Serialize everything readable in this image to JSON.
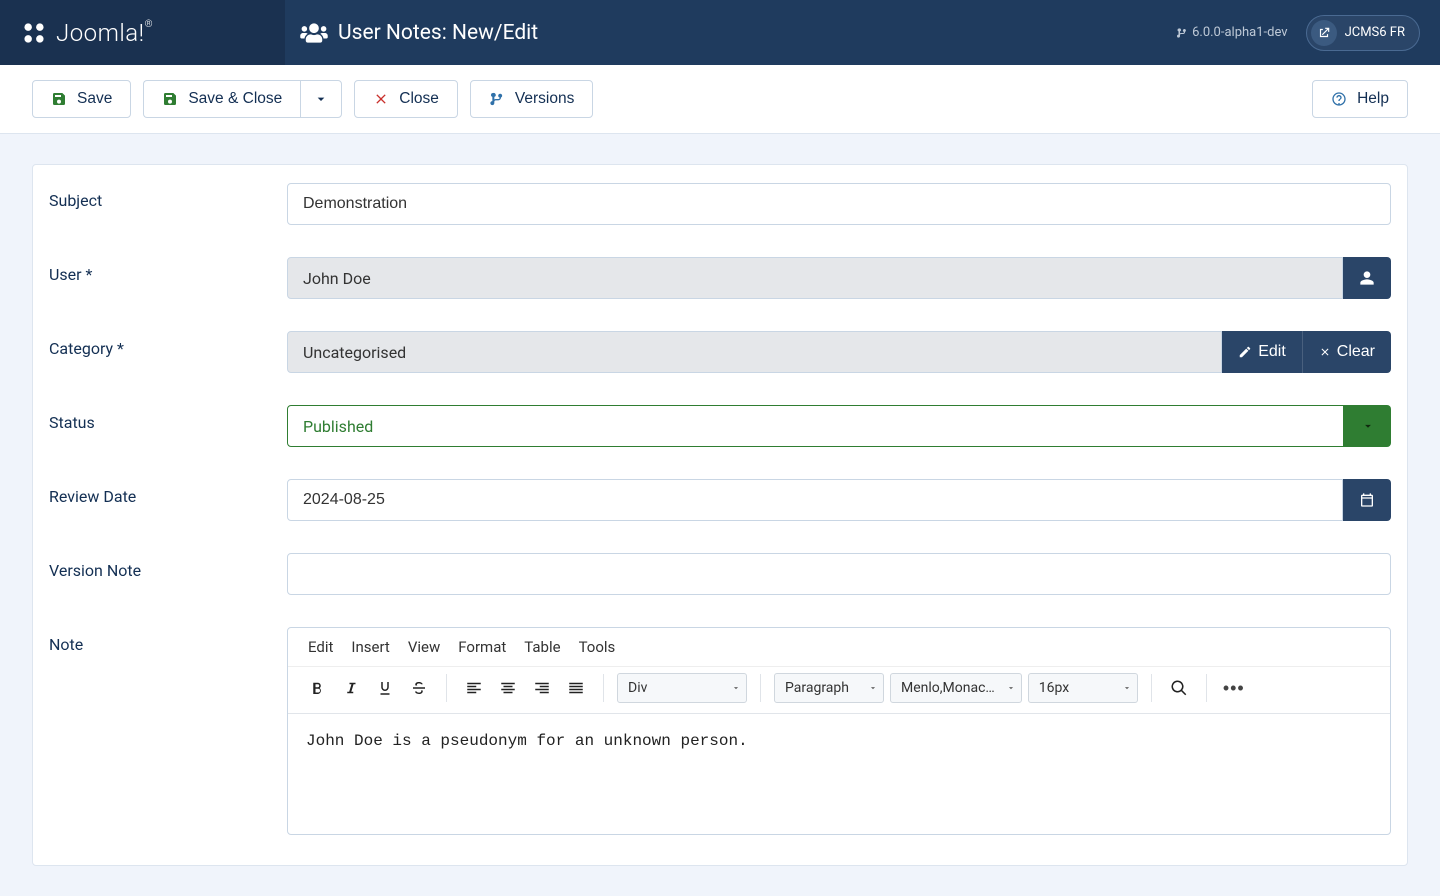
{
  "header": {
    "logo_text": "Joomla!",
    "logo_reg": "®",
    "page_title": "User Notes: New/Edit",
    "version_label": "6.0.0-alpha1-dev",
    "site_label": "JCMS6 FR"
  },
  "toolbar": {
    "save": "Save",
    "save_close": "Save & Close",
    "close": "Close",
    "versions": "Versions",
    "help": "Help"
  },
  "form": {
    "subject": {
      "label": "Subject",
      "value": "Demonstration"
    },
    "user": {
      "label": "User *",
      "value": "John Doe"
    },
    "category": {
      "label": "Category *",
      "value": "Uncategorised",
      "edit": "Edit",
      "clear": "Clear"
    },
    "status": {
      "label": "Status",
      "value": "Published"
    },
    "review_date": {
      "label": "Review Date",
      "value": "2024-08-25"
    },
    "version_note": {
      "label": "Version Note",
      "value": ""
    },
    "note": {
      "label": "Note"
    }
  },
  "editor": {
    "menus": [
      "Edit",
      "Insert",
      "View",
      "Format",
      "Table",
      "Tools"
    ],
    "select_block": "Div",
    "select_style": "Paragraph",
    "select_font": "Menlo,Monac…",
    "select_size": "16px",
    "body": "John Doe is a pseudonym for an unknown person."
  }
}
